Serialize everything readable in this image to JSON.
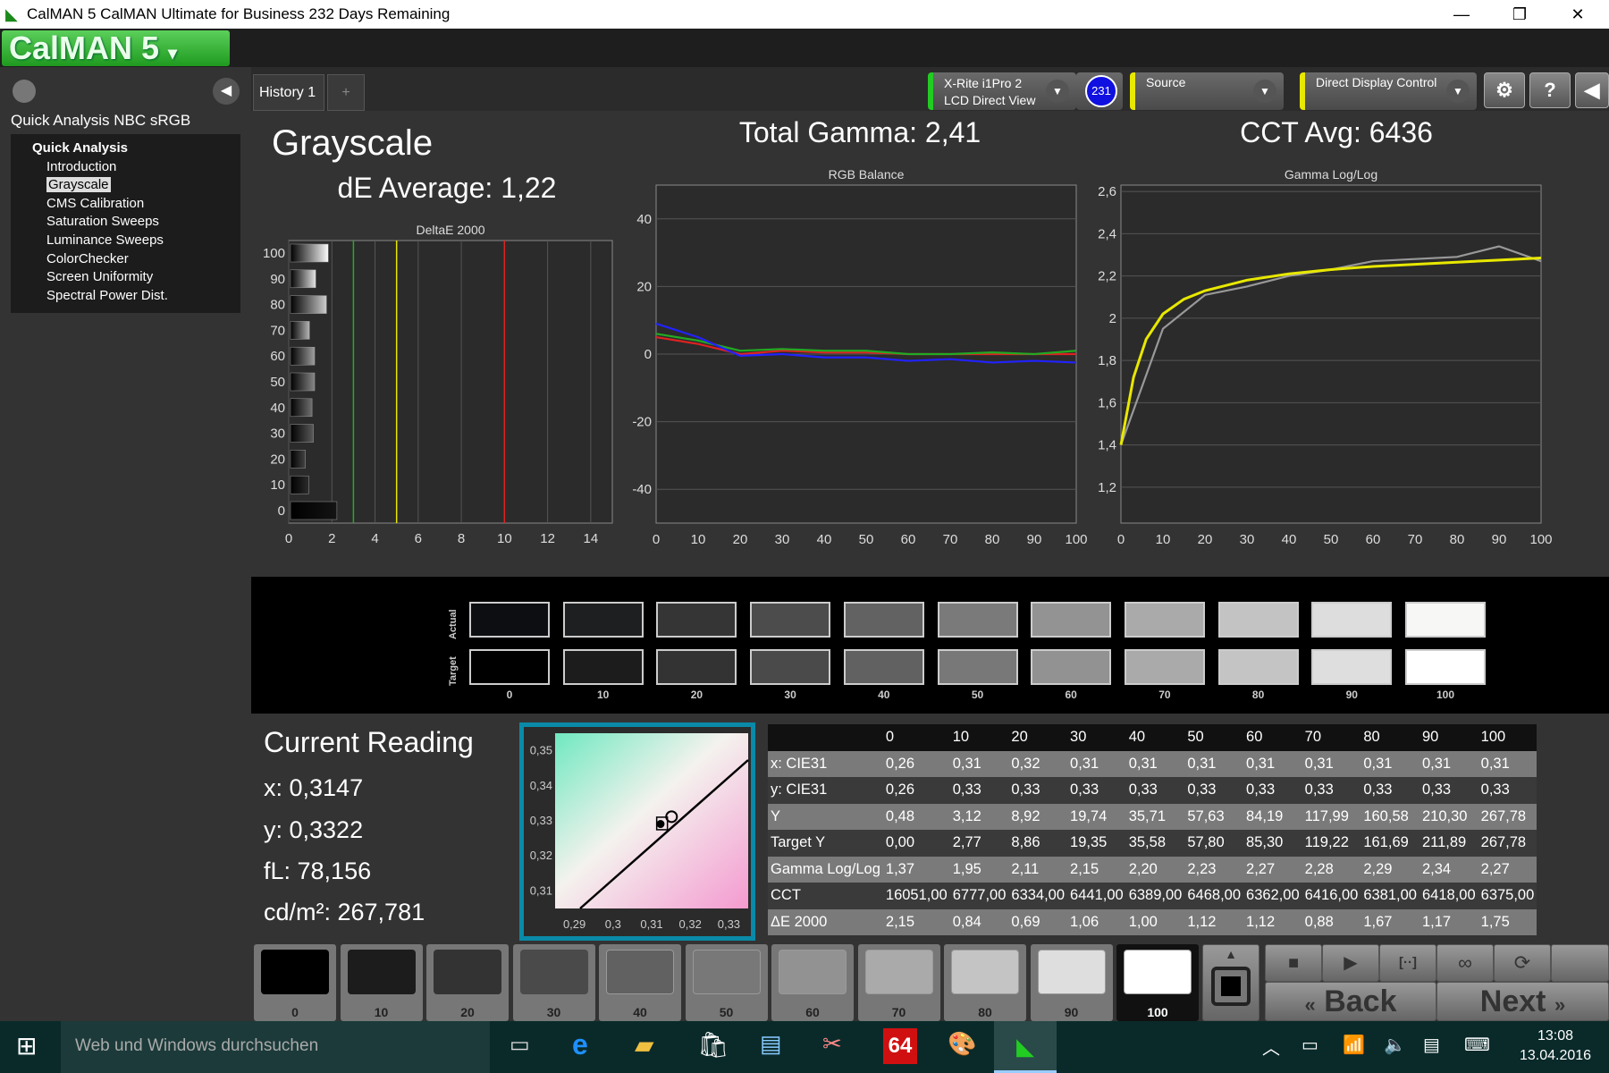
{
  "window": {
    "title": "CalMAN 5 CalMAN Ultimate for Business 232 Days Remaining",
    "logo": "CalMAN 5",
    "minimize": "—",
    "restore": "❐",
    "close": "✕"
  },
  "sidebar": {
    "workflow_title": "Quick Analysis NBC sRGB",
    "group": "Quick Analysis",
    "items": [
      {
        "label": "Introduction"
      },
      {
        "label": "Grayscale",
        "selected": true
      },
      {
        "label": "CMS Calibration"
      },
      {
        "label": "Saturation Sweeps"
      },
      {
        "label": "Luminance Sweeps"
      },
      {
        "label": "ColorChecker"
      },
      {
        "label": "Screen Uniformity"
      },
      {
        "label": "Spectral Power Dist."
      }
    ]
  },
  "tabs": [
    {
      "label": "History 1"
    },
    {
      "label": "+"
    }
  ],
  "toolbar": {
    "meter_line1": "X-Rite i1Pro 2",
    "meter_line2": "LCD Direct View",
    "meter_badge": "231",
    "source": "Source",
    "display": "Direct Display Control",
    "meter_color": "#22cc22",
    "source_color": "#e8e800",
    "display_color": "#e8e800"
  },
  "page": {
    "title": "Grayscale",
    "total_gamma": "Total Gamma: 2,41",
    "cct_avg": "CCT Avg: 6436",
    "de_avg": "dE Average: 1,22"
  },
  "chart_data": [
    {
      "type": "bar",
      "title": "DeltaE 2000",
      "orientation": "horizontal",
      "categories": [
        "0",
        "10",
        "20",
        "30",
        "40",
        "50",
        "60",
        "70",
        "80",
        "90",
        "100"
      ],
      "values": [
        2.15,
        0.84,
        0.69,
        1.06,
        1.0,
        1.12,
        1.12,
        0.88,
        1.67,
        1.17,
        1.75
      ],
      "xlim": [
        0,
        15
      ],
      "xticks": [
        0,
        2,
        4,
        6,
        8,
        10,
        12,
        14
      ],
      "thresholds": [
        {
          "value": 3,
          "color": "#22aa22"
        },
        {
          "value": 5,
          "color": "#e8e800"
        },
        {
          "value": 10,
          "color": "#dd2222"
        }
      ],
      "grid": true
    },
    {
      "type": "line",
      "title": "RGB Balance",
      "x": [
        0,
        10,
        20,
        30,
        40,
        50,
        60,
        70,
        80,
        90,
        100
      ],
      "ylim": [
        -50,
        50
      ],
      "yticks": [
        40,
        20,
        0,
        -20,
        -40
      ],
      "xticks": [
        0,
        10,
        20,
        30,
        40,
        50,
        60,
        70,
        80,
        90,
        100
      ],
      "grid": true,
      "series": [
        {
          "color": "#dd2222",
          "values": [
            5,
            3,
            0,
            1,
            0.5,
            0.5,
            0,
            0,
            0,
            0,
            0
          ]
        },
        {
          "color": "#22aa22",
          "values": [
            6,
            4,
            1,
            1.5,
            1,
            1,
            0,
            0,
            0.5,
            0,
            1
          ]
        },
        {
          "color": "#2222ff",
          "values": [
            9,
            5,
            -0.5,
            0,
            -1,
            -1,
            -2,
            -1.5,
            -2.5,
            -2,
            -2.5
          ]
        }
      ]
    },
    {
      "type": "line",
      "title": "Gamma Log/Log",
      "x": [
        0,
        10,
        20,
        30,
        40,
        50,
        60,
        70,
        80,
        90,
        100
      ],
      "ylim": [
        1.03,
        2.63
      ],
      "yticks": [
        "2,6",
        "2,4",
        "2,2",
        "2",
        "1,8",
        "1,6",
        "1,4",
        "1,2"
      ],
      "ytick_values": [
        2.6,
        2.4,
        2.2,
        2.0,
        1.8,
        1.6,
        1.4,
        1.2
      ],
      "xticks": [
        0,
        10,
        20,
        30,
        40,
        50,
        60,
        70,
        80,
        90,
        100
      ],
      "grid": true,
      "series": [
        {
          "color": "#999999",
          "values": [
            1.4,
            1.95,
            2.11,
            2.15,
            2.2,
            2.23,
            2.27,
            2.28,
            2.29,
            2.34,
            2.27
          ]
        },
        {
          "color": "#e8e800",
          "x": [
            0,
            3,
            6,
            10,
            15,
            20,
            30,
            40,
            50,
            60,
            70,
            80,
            90,
            100
          ],
          "values": [
            1.4,
            1.72,
            1.9,
            2.02,
            2.09,
            2.13,
            2.18,
            2.21,
            2.23,
            2.245,
            2.255,
            2.265,
            2.275,
            2.285
          ]
        }
      ]
    },
    {
      "type": "scatter",
      "title": "",
      "xticks": [
        "0,29",
        "0,3",
        "0,31",
        "0,32",
        "0,33"
      ],
      "yticks": [
        "0,35",
        "0,34",
        "0,33",
        "0,32",
        "0,31"
      ],
      "xlim": [
        0.285,
        0.335
      ],
      "ylim": [
        0.305,
        0.355
      ],
      "points": [
        {
          "x": 0.3147,
          "y": 0.3322
        }
      ]
    }
  ],
  "swatches": {
    "actual_label": "Actual",
    "target_label": "Target",
    "labels": [
      "0",
      "10",
      "20",
      "30",
      "40",
      "50",
      "60",
      "70",
      "80",
      "90",
      "100"
    ],
    "actual": [
      "#0c0e12",
      "#1e1f21",
      "#353535",
      "#4c4c4c",
      "#626262",
      "#7a7a7a",
      "#939393",
      "#aaaaaa",
      "#c3c3c3",
      "#dddddd",
      "#f7f7f5"
    ],
    "target": [
      "#000000",
      "#1c1c1c",
      "#333333",
      "#4a4a4a",
      "#616161",
      "#787878",
      "#929292",
      "#aaaaaa",
      "#c4c4c4",
      "#dedede",
      "#ffffff"
    ]
  },
  "reading": {
    "title": "Current Reading",
    "x": "x: 0,3147",
    "y": "y: 0,3322",
    "fl": "fL: 78,156",
    "cdm2": "cd/m²: 267,781"
  },
  "table": {
    "headers": [
      "",
      "0",
      "10",
      "20",
      "30",
      "40",
      "50",
      "60",
      "70",
      "80",
      "90",
      "100"
    ],
    "rows": [
      [
        "x: CIE31",
        "0,26",
        "0,31",
        "0,32",
        "0,31",
        "0,31",
        "0,31",
        "0,31",
        "0,31",
        "0,31",
        "0,31",
        "0,31"
      ],
      [
        "y: CIE31",
        "0,26",
        "0,33",
        "0,33",
        "0,33",
        "0,33",
        "0,33",
        "0,33",
        "0,33",
        "0,33",
        "0,33",
        "0,33"
      ],
      [
        "Y",
        "0,48",
        "3,12",
        "8,92",
        "19,74",
        "35,71",
        "57,63",
        "84,19",
        "117,99",
        "160,58",
        "210,30",
        "267,78"
      ],
      [
        "Target Y",
        "0,00",
        "2,77",
        "8,86",
        "19,35",
        "35,58",
        "57,80",
        "85,30",
        "119,22",
        "161,69",
        "211,89",
        "267,78"
      ],
      [
        "Gamma Log/Log",
        "1,37",
        "1,95",
        "2,11",
        "2,15",
        "2,20",
        "2,23",
        "2,27",
        "2,28",
        "2,29",
        "2,34",
        "2,27"
      ],
      [
        "CCT",
        "16051,00",
        "6777,00",
        "6334,00",
        "6441,00",
        "6389,00",
        "6468,00",
        "6362,00",
        "6416,00",
        "6381,00",
        "6418,00",
        "6375,00"
      ],
      [
        "ΔE 2000",
        "2,15",
        "0,84",
        "0,69",
        "1,06",
        "1,00",
        "1,12",
        "1,12",
        "0,88",
        "1,67",
        "1,17",
        "1,75"
      ]
    ]
  },
  "patch_buttons": {
    "labels": [
      "0",
      "10",
      "20",
      "30",
      "40",
      "50",
      "60",
      "70",
      "80",
      "90",
      "100"
    ],
    "selected": "100"
  },
  "controls": {
    "back": "Back",
    "next": "Next"
  },
  "taskbar": {
    "search_placeholder": "Web und Windows durchsuchen",
    "time": "13:08",
    "date": "13.04.2016",
    "pinned_badge": "64"
  }
}
